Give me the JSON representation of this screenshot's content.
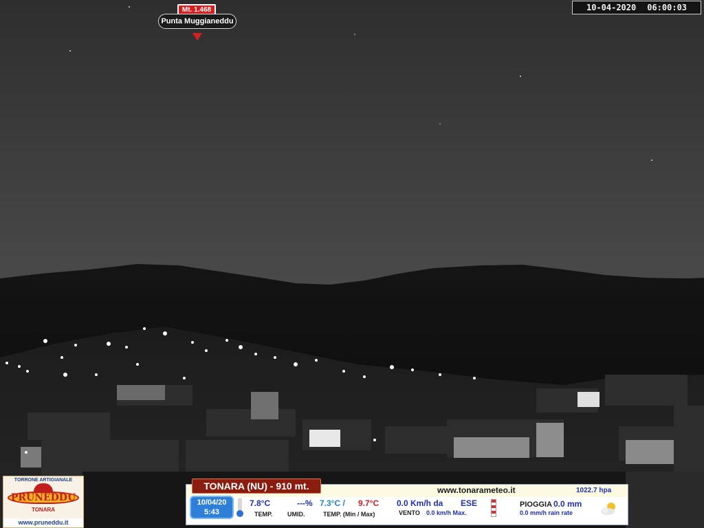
{
  "overlay": {
    "timestamp_date": "10-04-2020",
    "timestamp_time": "06:00:03",
    "peak_altitude": "Mt. 1.468",
    "peak_name": "Punta Muggianeddu"
  },
  "sponsor": {
    "tagline": "TORRONE ARTIGIANALE",
    "brand": "PRUNEDDU",
    "town": "TONARA",
    "url": "www.pruneddu.it"
  },
  "weather": {
    "title": "TONARA (NU) - 910 mt.",
    "website": "www.tonarameteo.it",
    "pressure": "1022.7  hpa",
    "date": "10/04/20",
    "time": "5:43",
    "temperature": "7.8°C",
    "temp_label": "TEMP.",
    "humidity": "---%",
    "humidity_label": "UMID.",
    "temp_min": "7.3°C /",
    "temp_max": "9.7°C",
    "minmax_label": "TEMP. (Min / Max)",
    "wind_speed": "0.0  Km/h da",
    "wind_dir": "ESE",
    "wind_label": "VENTO",
    "wind_max": "0.0  km/h Max.",
    "rain_label": "PIOGGIA",
    "rain": "0.0 mm",
    "rain_rate": "0.0 mm/h rain rate"
  },
  "colors": {
    "title_bar": "#8a1d10",
    "date_box": "#2d7fd8",
    "marker": "#d42020"
  }
}
